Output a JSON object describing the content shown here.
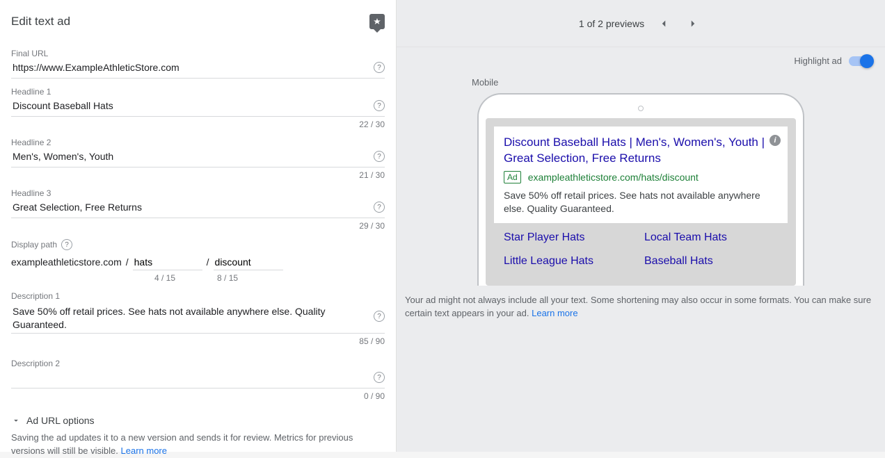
{
  "editor": {
    "title": "Edit text ad",
    "final_url_label": "Final URL",
    "final_url": "https://www.ExampleAthleticStore.com",
    "headline1_label": "Headline 1",
    "headline1": "Discount Baseball Hats",
    "headline1_count": "22 / 30",
    "headline2_label": "Headline 2",
    "headline2": "Men's, Women's, Youth",
    "headline2_count": "21 / 30",
    "headline3_label": "Headline 3",
    "headline3": "Great Selection, Free Returns",
    "headline3_count": "29 / 30",
    "display_path_label": "Display path",
    "display_domain": "exampleathleticstore.com",
    "path1": "hats",
    "path1_count": "4 / 15",
    "path2": "discount",
    "path2_count": "8 / 15",
    "description1_label": "Description 1",
    "description1": "Save 50% off retail prices. See hats not available anywhere else. Quality Guaranteed.",
    "description1_count": "85 / 90",
    "description2_label": "Description 2",
    "description2": "",
    "description2_count": "0 / 90",
    "url_options_label": "Ad URL options",
    "save_note_a": "Saving the ad updates it to a new version and sends it for review. Metrics for previous versions will still be visible. ",
    "learn_more": "Learn more"
  },
  "preview": {
    "counter": "1 of 2 previews",
    "highlight_label": "Highlight ad",
    "mobile_label": "Mobile",
    "ad": {
      "headline": "Discount Baseball Hats | Men's, Women's, Youth | Great Selection, Free Returns",
      "tag": "Ad",
      "url": "exampleathleticstore.com/hats/discount",
      "description": "Save 50% off retail prices. See hats not available anywhere else. Quality Guaranteed.",
      "sitelinks": [
        "Star Player Hats",
        "Local Team Hats",
        "Little League Hats",
        "Baseball Hats"
      ]
    },
    "disclaimer_a": "Your ad might not always include all your text. Some shortening may also occur in some formats. You can make sure certain text appears in your ad. ",
    "disclaimer_link": "Learn more"
  }
}
